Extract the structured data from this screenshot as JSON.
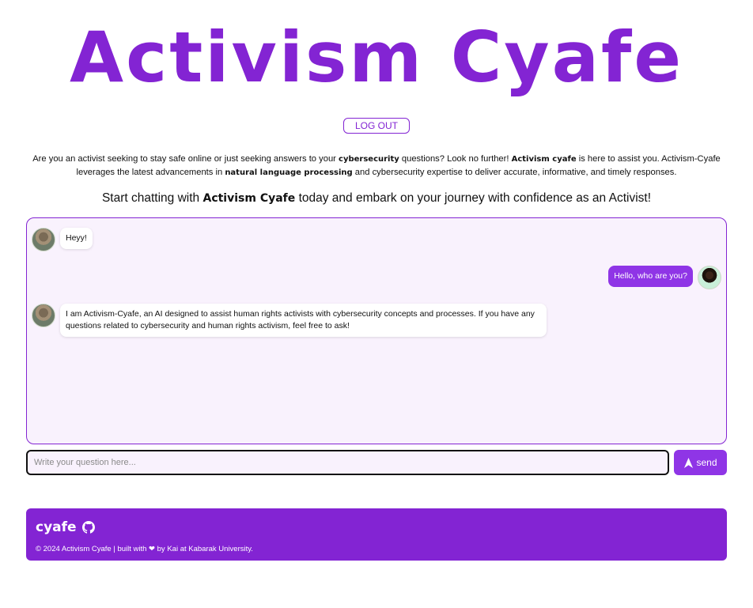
{
  "header": {
    "title": "Activism Cyafe",
    "logout_label": "LOG OUT"
  },
  "intro": {
    "p1": "Are you an activist seeking to stay safe online or just seeking answers to your ",
    "b1": "cybersecurity",
    "p2": " questions? Look no further! ",
    "b2": "Activism cyafe",
    "p3": " is here to assist you. Activism-Cyafe leverages the latest advancements in ",
    "b3": "natural language processing",
    "p4": " and cybersecurity expertise to deliver accurate, informative, and timely responses."
  },
  "cta": {
    "p1": "Start chatting with ",
    "b1": "Activism Cyafe",
    "p2": " today and embark on your journey with confidence as an Activist!"
  },
  "chat": {
    "messages": [
      {
        "sender": "bot",
        "text": "Heyy!"
      },
      {
        "sender": "user",
        "text": "Hello, who are you?"
      },
      {
        "sender": "bot",
        "text": "I am Activism-Cyafe, an AI designed to assist human rights activists with cybersecurity concepts and processes. If you have any questions related to cybersecurity and human rights activism, feel free to ask!"
      }
    ]
  },
  "composer": {
    "placeholder": "Write your question here...",
    "send_label": "send"
  },
  "footer": {
    "brand": "cyafe",
    "copyright": "© 2024 Activism Cyafe | built with ❤ by Kai at Kabarak University."
  },
  "colors": {
    "brand_purple": "#8324d3",
    "button_purple": "#8f35e6",
    "chat_bg": "#f9f2fd"
  },
  "icons": [
    "send-arrow-icon",
    "github-icon",
    "bot-avatar",
    "user-avatar"
  ]
}
